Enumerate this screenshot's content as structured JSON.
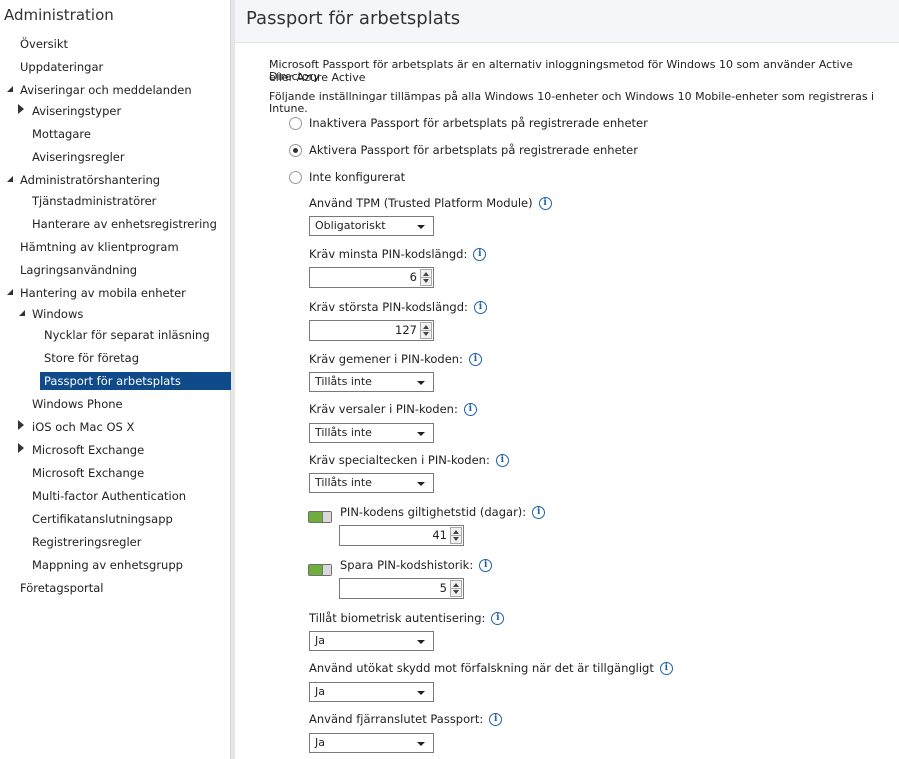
{
  "sidebar": {
    "title": "Administration",
    "items": [
      {
        "label": "Översikt"
      },
      {
        "label": "Uppdateringar"
      },
      {
        "label": "Aviseringar och meddelanden"
      },
      {
        "label": "Aviseringstyper"
      },
      {
        "label": "Mottagare"
      },
      {
        "label": "Aviseringsregler"
      },
      {
        "label": "Administratörshantering"
      },
      {
        "label": "Tjänstadministratörer"
      },
      {
        "label": "Hanterare av enhetsregistrering"
      },
      {
        "label": "Hämtning av klientprogram"
      },
      {
        "label": "Lagringsanvändning"
      },
      {
        "label": "Hantering av mobila enheter"
      },
      {
        "label": "Windows"
      },
      {
        "label": "Nycklar för separat inläsning"
      },
      {
        "label": "Store för företag"
      },
      {
        "label": "Passport för arbetsplats"
      },
      {
        "label": "Windows Phone"
      },
      {
        "label": "iOS och Mac OS X"
      },
      {
        "label": "Microsoft Exchange"
      },
      {
        "label": "Microsoft Exchange"
      },
      {
        "label": "Multi-factor Authentication"
      },
      {
        "label": "Certifikatanslutningsapp"
      },
      {
        "label": "Registreringsregler"
      },
      {
        "label": "Mappning av enhetsgrupp"
      },
      {
        "label": "Företagsportal"
      }
    ]
  },
  "main": {
    "title": "Passport för arbetsplats",
    "description_line1": "Microsoft Passport för arbetsplats är en alternativ inloggningsmetod för Windows 10 som använder Active Directory",
    "description_line2": "eller Azure Active",
    "description_line3": "Följande inställningar tillämpas på alla Windows 10-enheter och Windows 10 Mobile-enheter som registreras i Intune.",
    "radios": [
      {
        "label": "Inaktivera Passport för arbetsplats på registrerade enheter",
        "checked": false
      },
      {
        "label": "Aktivera Passport för arbetsplats på registrerade enheter",
        "checked": true
      },
      {
        "label": "Inte konfigurerat",
        "checked": false
      }
    ],
    "tpm": {
      "label": "Använd TPM (Trusted Platform Module)",
      "value": "Obligatoriskt"
    },
    "min_pin": {
      "label": "Kräv minsta PIN-kodslängd:",
      "value": "6"
    },
    "max_pin": {
      "label": "Kräv största PIN-kodslängd:",
      "value": "127"
    },
    "lowercase": {
      "label": "Kräv gemener i PIN-koden:",
      "value": "Tillåts inte"
    },
    "uppercase": {
      "label": "Kräv versaler i PIN-koden:",
      "value": "Tillåts inte"
    },
    "special": {
      "label": "Kräv specialtecken i PIN-koden:",
      "value": "Tillåts inte"
    },
    "expiry": {
      "label": "PIN-kodens giltighetstid (dagar):",
      "value": "41",
      "enabled": true
    },
    "history": {
      "label": "Spara PIN-kodshistorik:",
      "value": "5",
      "enabled": true
    },
    "biometric": {
      "label": "Tillåt biometrisk autentisering:",
      "value": "Ja"
    },
    "antispoof": {
      "label": "Använd utökat skydd mot förfalskning när det är tillgängligt",
      "value": "Ja"
    },
    "remote": {
      "label": "Använd fjärranslutet Passport:",
      "value": "Ja"
    }
  },
  "colors": {
    "selected": "#0f4a8a",
    "toggle_on": "#6fae3e",
    "info": "#1f5fa8"
  }
}
